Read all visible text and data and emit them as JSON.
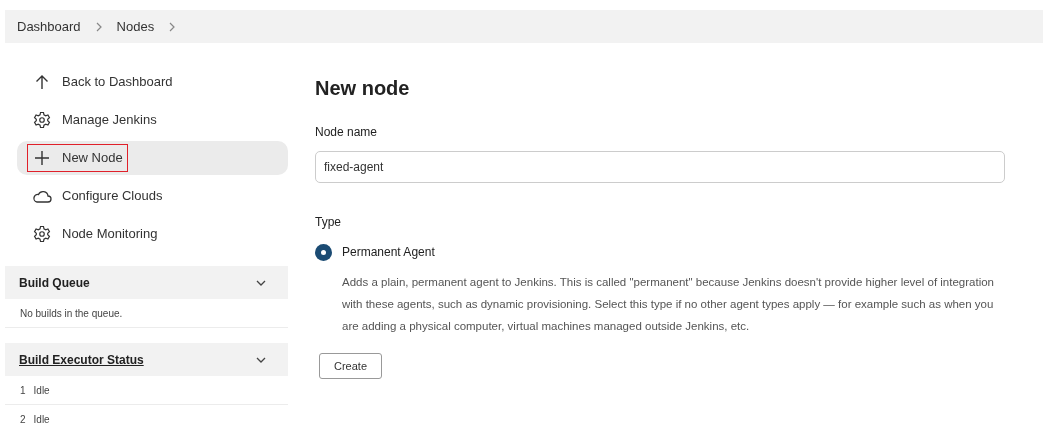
{
  "breadcrumbs": [
    {
      "label": "Dashboard"
    },
    {
      "label": "Nodes"
    }
  ],
  "sidebar": {
    "items": [
      {
        "label": "Back to Dashboard",
        "selected": false,
        "highlighted": false
      },
      {
        "label": "Manage Jenkins",
        "selected": false,
        "highlighted": false
      },
      {
        "label": "New Node",
        "selected": true,
        "highlighted": true
      },
      {
        "label": "Configure Clouds",
        "selected": false,
        "highlighted": false
      },
      {
        "label": "Node Monitoring",
        "selected": false,
        "highlighted": false
      }
    ]
  },
  "panels": [
    {
      "title": "Build Queue",
      "link": false,
      "expanded": true,
      "rows": [
        {
          "text": "No builds in the queue."
        }
      ]
    },
    {
      "title": "Build Executor Status",
      "link": true,
      "expanded": true,
      "rows": [
        {
          "number": "1",
          "text": "Idle"
        },
        {
          "number": "2",
          "text": "Idle"
        }
      ]
    }
  ],
  "main": {
    "title": "New node",
    "name_label": "Node name",
    "name_value": "fixed-agent",
    "type_label": "Type",
    "types": [
      {
        "label": "Permanent Agent",
        "selected": true,
        "description": "Adds a plain, permanent agent to Jenkins. This is called \"permanent\" because Jenkins doesn't provide higher level of integration with these agents, such as dynamic provisioning. Select this type if no other agent types apply — for example such as when you are adding a physical computer, virtual machines managed outside Jenkins, etc."
      }
    ],
    "button": "Create"
  }
}
